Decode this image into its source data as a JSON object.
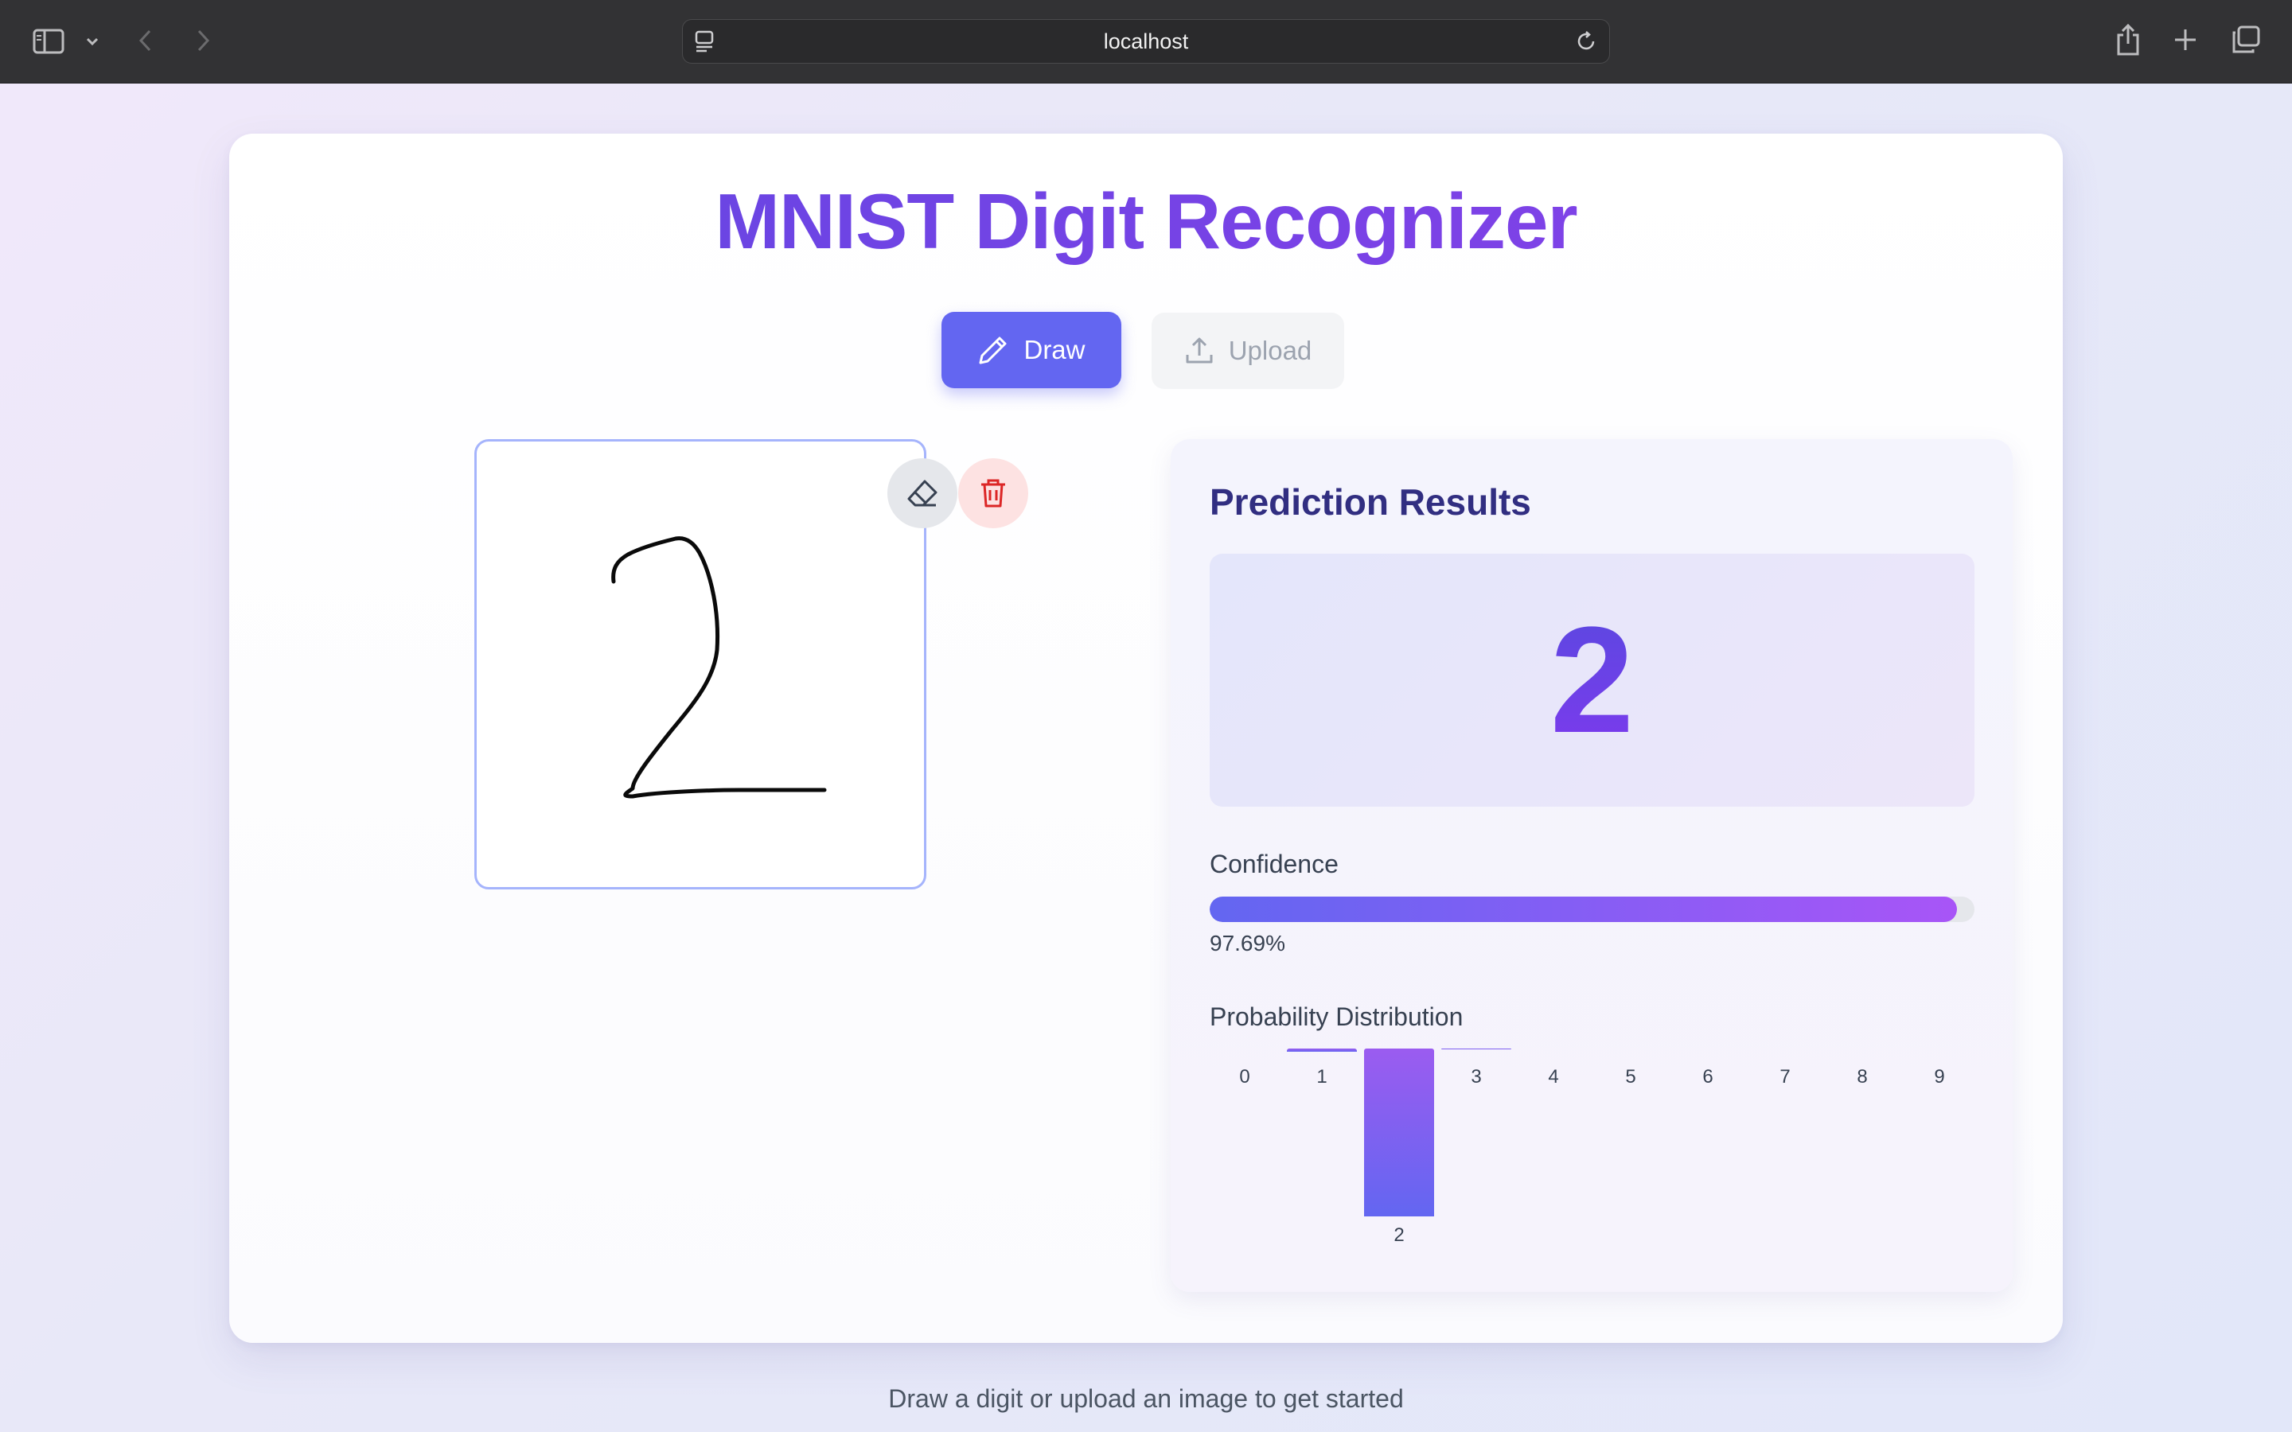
{
  "browser": {
    "url": "localhost"
  },
  "app": {
    "title": "MNIST Digit Recognizer",
    "modes": {
      "draw_label": "Draw",
      "upload_label": "Upload",
      "active": "Draw"
    },
    "footer_hint": "Draw a digit or upload an image to get started"
  },
  "canvas": {
    "drawn_digit": "2",
    "tools": [
      "eraser-icon",
      "trash-icon"
    ]
  },
  "results": {
    "title": "Prediction Results",
    "predicted_digit": "2",
    "confidence_label": "Confidence",
    "confidence_value": "97.69%",
    "confidence_fraction": 0.9769,
    "distribution_label": "Probability Distribution"
  },
  "colors": {
    "accent": "#6366f1",
    "accent_purple": "#a855f7",
    "trash": "#dc2626",
    "title_dark": "#312e81"
  },
  "chart_data": {
    "type": "bar",
    "categories": [
      "0",
      "1",
      "2",
      "3",
      "4",
      "5",
      "6",
      "7",
      "8",
      "9"
    ],
    "values": [
      0.0,
      0.02,
      0.9769,
      0.005,
      0.0,
      0.0,
      0.0,
      0.0,
      0.0,
      0.0
    ],
    "ylim": [
      0,
      1
    ],
    "title": "Probability Distribution",
    "grid": false
  }
}
